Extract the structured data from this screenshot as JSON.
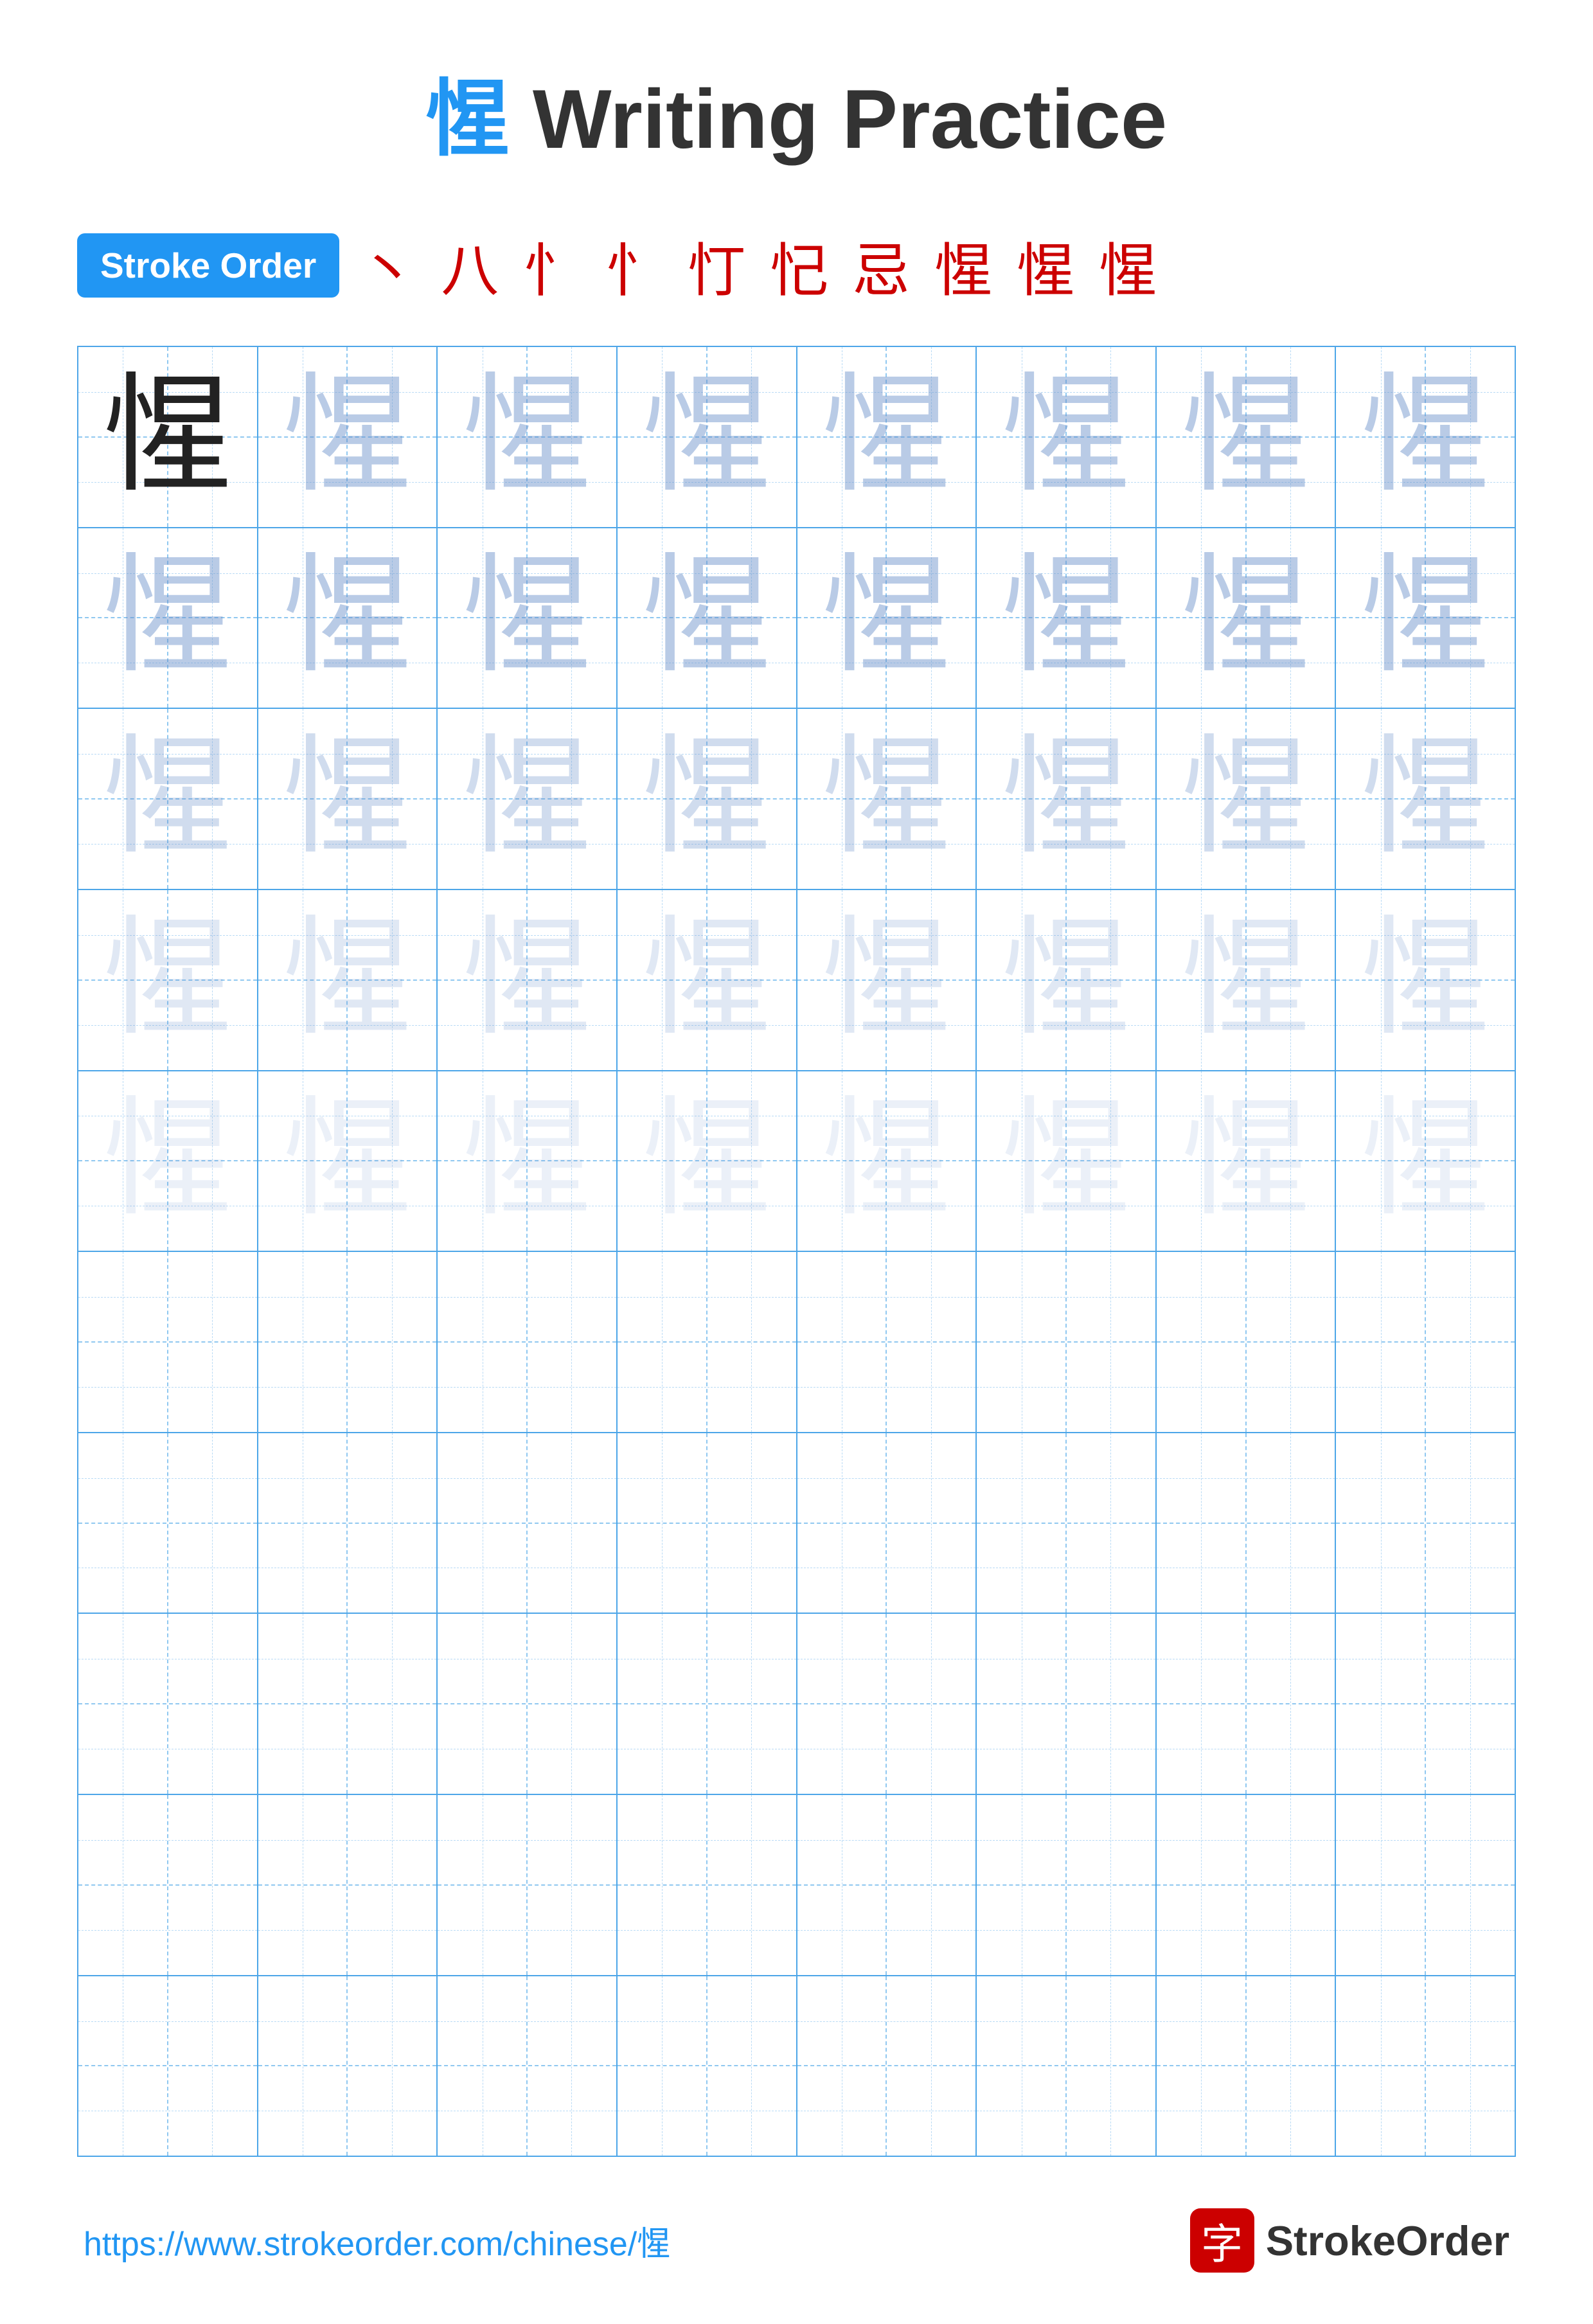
{
  "title": {
    "char": "惺",
    "text": " Writing Practice"
  },
  "stroke_order": {
    "badge_label": "Stroke Order",
    "strokes": [
      "丶",
      "八",
      "忄",
      "忄",
      "忊",
      "忋",
      "忌",
      "惺",
      "惺",
      "惺"
    ]
  },
  "grid": {
    "rows": 10,
    "cols": 8,
    "char": "惺",
    "practice_rows": 5,
    "empty_rows": 5
  },
  "footer": {
    "url": "https://www.strokeorder.com/chinese/惺",
    "logo_char": "字",
    "logo_text": "StrokeOrder"
  }
}
